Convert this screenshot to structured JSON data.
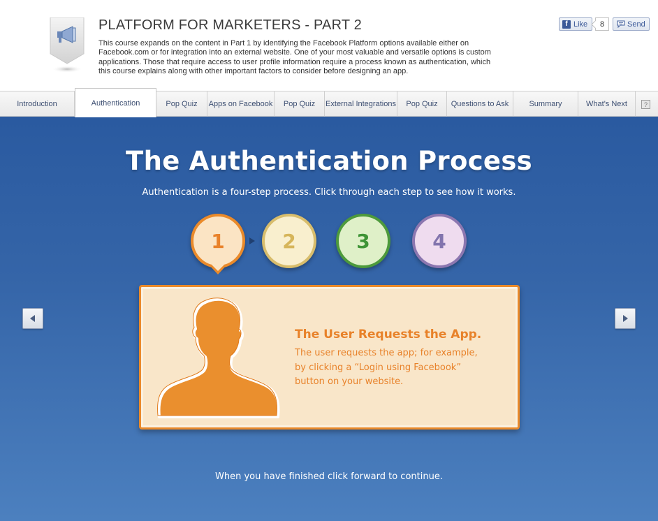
{
  "course": {
    "title": "PLATFORM FOR MARKETERS - PART 2",
    "description": "This course expands on the content in Part 1 by identifying the Facebook Platform options available either on Facebook.com or for integration into an external website. One of your most valuable and versatile options is custom applications. Those that require access to user profile information require a process known as authentication, which this course explains along with other important factors to consider before designing an app.",
    "icon": "megaphone-icon"
  },
  "social": {
    "like_label": "Like",
    "like_count": "8",
    "send_label": "Send"
  },
  "tabs": [
    {
      "label": "Introduction"
    },
    {
      "label": "Authentication"
    },
    {
      "label": "Pop Quiz"
    },
    {
      "label": "Apps on Facebook"
    },
    {
      "label": "Pop Quiz"
    },
    {
      "label": "External Integrations"
    },
    {
      "label": "Pop Quiz"
    },
    {
      "label": "Questions to Ask"
    },
    {
      "label": "Summary"
    },
    {
      "label": "What's Next"
    }
  ],
  "active_tab": "Authentication",
  "help_label": "?",
  "stage": {
    "title": "The Authentication Process",
    "subtitle": "Authentication is a four-step process. Click through each step to see how it works.",
    "footer": "When you have finished click forward to continue.",
    "steps": [
      {
        "number": "1",
        "color": "#ea8a2a"
      },
      {
        "number": "2",
        "color": "#d8bd6c"
      },
      {
        "number": "3",
        "color": "#4d9a3c"
      },
      {
        "number": "4",
        "color": "#8c77b0"
      }
    ],
    "active_step": "1",
    "card": {
      "title": "The User Requests the App.",
      "text": "The user requests the app; for example, by clicking a “Login using Facebook” button on your website."
    }
  },
  "colors": {
    "accent": "#ea8a2a",
    "stage_bg": "#3565a8",
    "tab_text": "#3d4f72"
  }
}
